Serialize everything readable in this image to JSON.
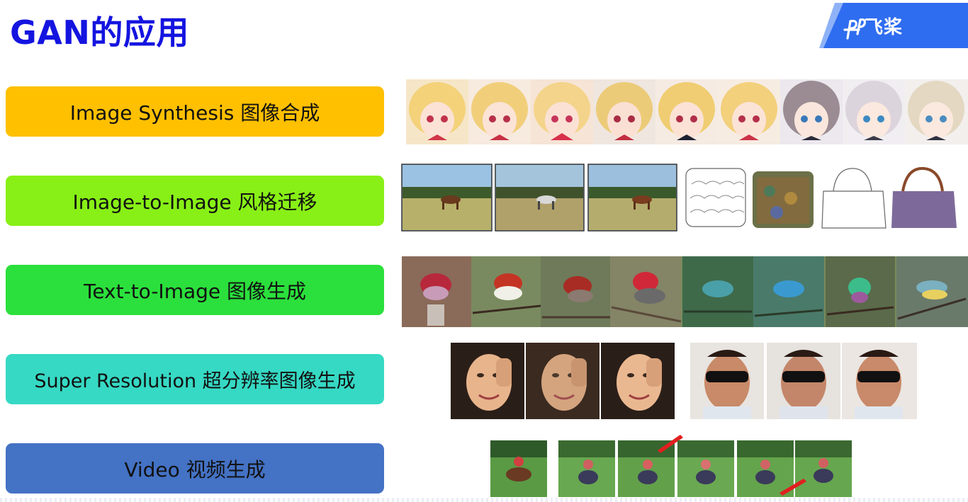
{
  "slide": {
    "title": "GAN的应用",
    "logo_text": "飞桨",
    "brand_color": "#1414e0",
    "logo_color": "#2f6df0"
  },
  "applications": [
    {
      "label": "Image Synthesis 图像合成",
      "color": "#ffc000"
    },
    {
      "label": "Image-to-Image 风格迁移",
      "color": "#88f016"
    },
    {
      "label": "Text-to-Image 图像生成",
      "color": "#2be03c"
    },
    {
      "label": "Super Resolution 超分辨率图像生成",
      "color": "#36d9c4"
    },
    {
      "label": "Video 视频生成",
      "color": "#4472c4"
    }
  ],
  "images": {
    "anime_faces": "anime-faces-strip",
    "style_transfer": "horse-zebra-and-bag-sketches",
    "birds": "generated-birds-strip",
    "super_resolution": "face-super-resolution-strip",
    "video": "video-frames-strip"
  }
}
